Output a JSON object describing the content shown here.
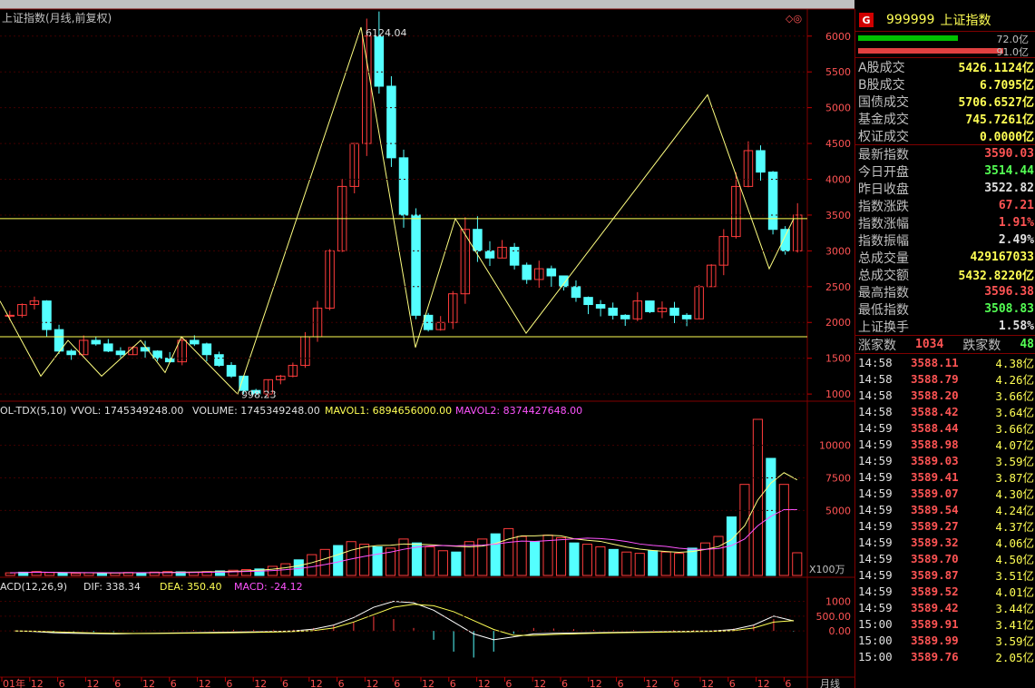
{
  "chart_title": "上证指数(月线,前复权)",
  "high_label": "6124.04",
  "low_label": "998.23",
  "top_right_markers": "◇◎",
  "price_axis": [
    "6000",
    "5500",
    "5000",
    "4500",
    "4000",
    "3500",
    "3000",
    "2500",
    "2000",
    "1500",
    "1000"
  ],
  "vol_indicator": {
    "name": "OL-TDX(5,10)",
    "vvol": "VVOL: 1745349248.00",
    "volume": "VOLUME: 1745349248.00",
    "mavol1": "MAVOL1: 6894656000.00",
    "mavol2": "MAVOL2: 8374427648.00"
  },
  "vol_axis": [
    "10000",
    "7500",
    "5000"
  ],
  "vol_unit": "X100万",
  "macd_indicator": {
    "name": "ACD(12,26,9)",
    "dif": "DIF: 338.34",
    "dea": "DEA: 350.40",
    "macd": "MACD: -24.12"
  },
  "macd_axis": [
    "1000",
    "500.00",
    "0.00"
  ],
  "x_axis": [
    "01年",
    "12",
    "6",
    "12",
    "6",
    "12",
    "6",
    "12",
    "6",
    "12",
    "6",
    "12",
    "6",
    "12",
    "6",
    "12",
    "6",
    "12",
    "6",
    "12",
    "6",
    "12",
    "6",
    "12",
    "6",
    "12",
    "6",
    "12",
    "6"
  ],
  "x_axis_unit": "月线",
  "chart_data": [
    {
      "type": "candlestick",
      "title": "上证指数(月线,前复权)",
      "annotations": [
        {
          "text": "6124.04",
          "value": 6124.04
        },
        {
          "text": "998.23",
          "value": 998.23
        }
      ],
      "horizontal_lines": [
        3450,
        1800
      ],
      "zigzag": [
        2300,
        1250,
        1750,
        1250,
        1750,
        1300,
        1800,
        998.23,
        6124.04,
        1650,
        3450,
        1850,
        5180,
        2750,
        3450
      ],
      "close_series": [
        2100,
        2250,
        2300,
        1900,
        1600,
        1550,
        1750,
        1700,
        1600,
        1550,
        1650,
        1600,
        1500,
        1450,
        1750,
        1700,
        1550,
        1400,
        1250,
        1050,
        1000,
        1200,
        1250,
        1400,
        1800,
        2200,
        3000,
        3900,
        4500,
        6000,
        5300,
        4300,
        3500,
        2100,
        1900,
        2000,
        2400,
        3300,
        3000,
        2900,
        3050,
        2800,
        2600,
        2750,
        2650,
        2500,
        2350,
        2250,
        2200,
        2100,
        2050,
        2300,
        2150,
        2200,
        2100,
        2050,
        2500,
        2800,
        3200,
        3900,
        4400,
        4100,
        3300,
        3000,
        3500
      ],
      "ylim": [
        900,
        6200
      ]
    },
    {
      "type": "bar",
      "title": "OL-TDX(5,10)",
      "series_names": [
        "VVOL",
        "MAVOL1",
        "MAVOL2"
      ],
      "unit": "X100万",
      "ylim": [
        0,
        12000
      ],
      "values": [
        200,
        250,
        300,
        220,
        180,
        160,
        200,
        210,
        190,
        230,
        200,
        260,
        300,
        280,
        250,
        300,
        350,
        400,
        450,
        500,
        700,
        900,
        1200,
        1600,
        2000,
        2300,
        2600,
        2400,
        2200,
        2100,
        2800,
        2500,
        2200,
        1900,
        1800,
        2600,
        2800,
        3200,
        3600,
        3000,
        2600,
        3100,
        2900,
        2500,
        2400,
        2200,
        2000,
        1800,
        1700,
        1900,
        1800,
        1700,
        2100,
        2500,
        3000,
        4500,
        7000,
        12000,
        9000,
        7000,
        1745
      ]
    },
    {
      "type": "line",
      "title": "ACD(12,26,9)",
      "series_names": [
        "DIF",
        "DEA",
        "MACD"
      ],
      "ylim": [
        -1500,
        1200
      ],
      "dif": [
        0,
        -20,
        -60,
        -80,
        -90,
        -100,
        -90,
        -80,
        -70,
        -60,
        -50,
        -40,
        -30,
        -20,
        0,
        60,
        200,
        450,
        800,
        1000,
        950,
        700,
        300,
        -100,
        -300,
        -200,
        -100,
        -80,
        -70,
        -60,
        -50,
        -40,
        -30,
        -20,
        -10,
        0,
        50,
        200,
        500,
        338.34
      ],
      "dea": [
        0,
        -10,
        -30,
        -50,
        -70,
        -80,
        -85,
        -85,
        -80,
        -75,
        -70,
        -60,
        -50,
        -40,
        -20,
        10,
        100,
        300,
        550,
        800,
        900,
        850,
        650,
        350,
        50,
        -150,
        -150,
        -120,
        -100,
        -80,
        -65,
        -55,
        -45,
        -35,
        -25,
        -15,
        10,
        100,
        300,
        350.4
      ],
      "macd_last": -24.12
    }
  ],
  "panel": {
    "code": "999999",
    "name": "上证指数",
    "badge": "G",
    "bars": [
      {
        "pct": "72.0亿",
        "color": "#00c000",
        "w": 110
      },
      {
        "pct": "91.0亿",
        "color": "#e04040",
        "w": 160
      }
    ],
    "rows1": [
      {
        "label": "A股成交",
        "value": "5426.1124亿",
        "cls": "y"
      },
      {
        "label": "B股成交",
        "value": "6.7095亿",
        "cls": "y"
      },
      {
        "label": "国债成交",
        "value": "5706.6527亿",
        "cls": "y"
      },
      {
        "label": "基金成交",
        "value": "745.7261亿",
        "cls": "y"
      },
      {
        "label": "权证成交",
        "value": "0.0000亿",
        "cls": "y"
      }
    ],
    "rows2": [
      {
        "label": "最新指数",
        "value": "3590.03",
        "cls": "r"
      },
      {
        "label": "今日开盘",
        "value": "3514.44",
        "cls": "g"
      },
      {
        "label": "昨日收盘",
        "value": "3522.82",
        "cls": "w"
      },
      {
        "label": "指数涨跌",
        "value": "67.21",
        "cls": "r"
      },
      {
        "label": "指数涨幅",
        "value": "1.91%",
        "cls": "r"
      },
      {
        "label": "指数振幅",
        "value": "2.49%",
        "cls": "w"
      },
      {
        "label": "总成交量",
        "value": "429167033",
        "cls": "y"
      },
      {
        "label": "总成交额",
        "value": "5432.8220亿",
        "cls": "y"
      },
      {
        "label": "最高指数",
        "value": "3596.38",
        "cls": "r"
      },
      {
        "label": "最低指数",
        "value": "3508.83",
        "cls": "g"
      },
      {
        "label": "上证换手",
        "value": "1.58%",
        "cls": "w"
      }
    ],
    "up_label": "涨家数",
    "up_value": "1034",
    "down_label": "跌家数",
    "down_value": "48",
    "ticks": [
      {
        "t": "14:58",
        "p": "3588.11",
        "v": "4.38亿"
      },
      {
        "t": "14:58",
        "p": "3588.79",
        "v": "4.26亿"
      },
      {
        "t": "14:58",
        "p": "3588.20",
        "v": "3.66亿"
      },
      {
        "t": "14:58",
        "p": "3588.42",
        "v": "3.64亿"
      },
      {
        "t": "14:59",
        "p": "3588.44",
        "v": "3.66亿"
      },
      {
        "t": "14:59",
        "p": "3588.98",
        "v": "4.07亿"
      },
      {
        "t": "14:59",
        "p": "3589.03",
        "v": "3.59亿"
      },
      {
        "t": "14:59",
        "p": "3589.41",
        "v": "3.87亿"
      },
      {
        "t": "14:59",
        "p": "3589.07",
        "v": "4.30亿"
      },
      {
        "t": "14:59",
        "p": "3589.54",
        "v": "4.24亿"
      },
      {
        "t": "14:59",
        "p": "3589.27",
        "v": "4.37亿"
      },
      {
        "t": "14:59",
        "p": "3589.32",
        "v": "4.06亿"
      },
      {
        "t": "14:59",
        "p": "3589.70",
        "v": "4.50亿"
      },
      {
        "t": "14:59",
        "p": "3589.87",
        "v": "3.51亿"
      },
      {
        "t": "14:59",
        "p": "3589.52",
        "v": "4.01亿"
      },
      {
        "t": "14:59",
        "p": "3589.42",
        "v": "3.44亿"
      },
      {
        "t": "15:00",
        "p": "3589.91",
        "v": "3.41亿"
      },
      {
        "t": "15:00",
        "p": "3589.99",
        "v": "3.59亿"
      },
      {
        "t": "15:00",
        "p": "3589.76",
        "v": "2.05亿"
      }
    ]
  }
}
